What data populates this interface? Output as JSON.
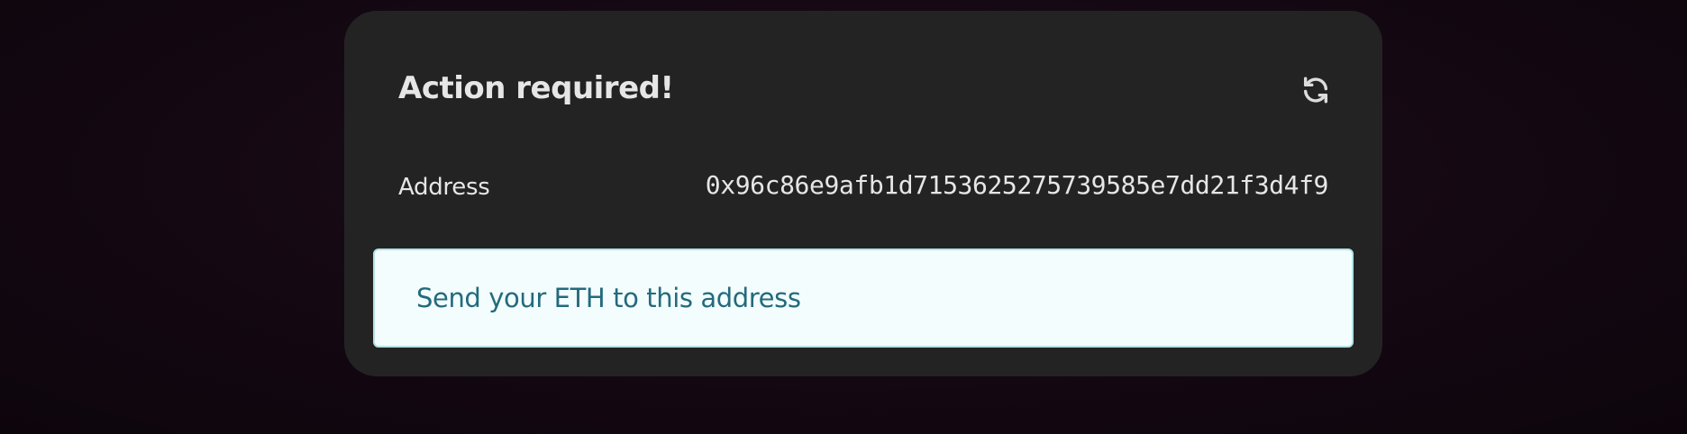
{
  "card": {
    "title": "Action required!",
    "refresh_icon": "refresh-icon",
    "address_label": "Address",
    "address_value": "0x96c86e9afb1d7153625275739585e7dd21f3d4f9",
    "notice_text": "Send your ETH to this address"
  },
  "colors": {
    "background": "#140812",
    "card_background": "#232323",
    "text": "#e6e6e6",
    "notice_background": "#f3fdfd",
    "notice_border": "#b3e2e7",
    "notice_text": "#236a7d"
  }
}
